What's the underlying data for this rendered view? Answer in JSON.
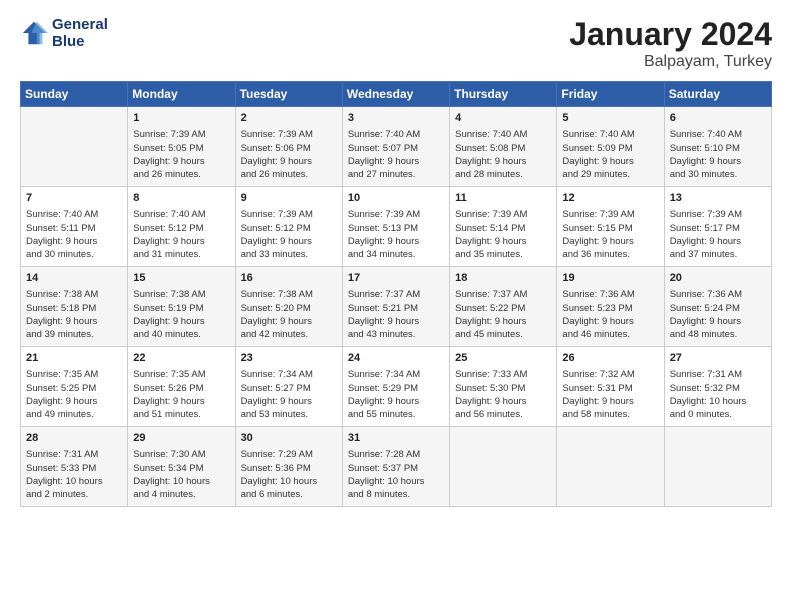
{
  "header": {
    "logo_line1": "General",
    "logo_line2": "Blue",
    "title": "January 2024",
    "subtitle": "Balpayam, Turkey"
  },
  "weekdays": [
    "Sunday",
    "Monday",
    "Tuesday",
    "Wednesday",
    "Thursday",
    "Friday",
    "Saturday"
  ],
  "weeks": [
    [
      {
        "day": "",
        "info": ""
      },
      {
        "day": "1",
        "info": "Sunrise: 7:39 AM\nSunset: 5:05 PM\nDaylight: 9 hours\nand 26 minutes."
      },
      {
        "day": "2",
        "info": "Sunrise: 7:39 AM\nSunset: 5:06 PM\nDaylight: 9 hours\nand 26 minutes."
      },
      {
        "day": "3",
        "info": "Sunrise: 7:40 AM\nSunset: 5:07 PM\nDaylight: 9 hours\nand 27 minutes."
      },
      {
        "day": "4",
        "info": "Sunrise: 7:40 AM\nSunset: 5:08 PM\nDaylight: 9 hours\nand 28 minutes."
      },
      {
        "day": "5",
        "info": "Sunrise: 7:40 AM\nSunset: 5:09 PM\nDaylight: 9 hours\nand 29 minutes."
      },
      {
        "day": "6",
        "info": "Sunrise: 7:40 AM\nSunset: 5:10 PM\nDaylight: 9 hours\nand 30 minutes."
      }
    ],
    [
      {
        "day": "7",
        "info": "Sunrise: 7:40 AM\nSunset: 5:11 PM\nDaylight: 9 hours\nand 30 minutes."
      },
      {
        "day": "8",
        "info": "Sunrise: 7:40 AM\nSunset: 5:12 PM\nDaylight: 9 hours\nand 31 minutes."
      },
      {
        "day": "9",
        "info": "Sunrise: 7:39 AM\nSunset: 5:12 PM\nDaylight: 9 hours\nand 33 minutes."
      },
      {
        "day": "10",
        "info": "Sunrise: 7:39 AM\nSunset: 5:13 PM\nDaylight: 9 hours\nand 34 minutes."
      },
      {
        "day": "11",
        "info": "Sunrise: 7:39 AM\nSunset: 5:14 PM\nDaylight: 9 hours\nand 35 minutes."
      },
      {
        "day": "12",
        "info": "Sunrise: 7:39 AM\nSunset: 5:15 PM\nDaylight: 9 hours\nand 36 minutes."
      },
      {
        "day": "13",
        "info": "Sunrise: 7:39 AM\nSunset: 5:17 PM\nDaylight: 9 hours\nand 37 minutes."
      }
    ],
    [
      {
        "day": "14",
        "info": "Sunrise: 7:38 AM\nSunset: 5:18 PM\nDaylight: 9 hours\nand 39 minutes."
      },
      {
        "day": "15",
        "info": "Sunrise: 7:38 AM\nSunset: 5:19 PM\nDaylight: 9 hours\nand 40 minutes."
      },
      {
        "day": "16",
        "info": "Sunrise: 7:38 AM\nSunset: 5:20 PM\nDaylight: 9 hours\nand 42 minutes."
      },
      {
        "day": "17",
        "info": "Sunrise: 7:37 AM\nSunset: 5:21 PM\nDaylight: 9 hours\nand 43 minutes."
      },
      {
        "day": "18",
        "info": "Sunrise: 7:37 AM\nSunset: 5:22 PM\nDaylight: 9 hours\nand 45 minutes."
      },
      {
        "day": "19",
        "info": "Sunrise: 7:36 AM\nSunset: 5:23 PM\nDaylight: 9 hours\nand 46 minutes."
      },
      {
        "day": "20",
        "info": "Sunrise: 7:36 AM\nSunset: 5:24 PM\nDaylight: 9 hours\nand 48 minutes."
      }
    ],
    [
      {
        "day": "21",
        "info": "Sunrise: 7:35 AM\nSunset: 5:25 PM\nDaylight: 9 hours\nand 49 minutes."
      },
      {
        "day": "22",
        "info": "Sunrise: 7:35 AM\nSunset: 5:26 PM\nDaylight: 9 hours\nand 51 minutes."
      },
      {
        "day": "23",
        "info": "Sunrise: 7:34 AM\nSunset: 5:27 PM\nDaylight: 9 hours\nand 53 minutes."
      },
      {
        "day": "24",
        "info": "Sunrise: 7:34 AM\nSunset: 5:29 PM\nDaylight: 9 hours\nand 55 minutes."
      },
      {
        "day": "25",
        "info": "Sunrise: 7:33 AM\nSunset: 5:30 PM\nDaylight: 9 hours\nand 56 minutes."
      },
      {
        "day": "26",
        "info": "Sunrise: 7:32 AM\nSunset: 5:31 PM\nDaylight: 9 hours\nand 58 minutes."
      },
      {
        "day": "27",
        "info": "Sunrise: 7:31 AM\nSunset: 5:32 PM\nDaylight: 10 hours\nand 0 minutes."
      }
    ],
    [
      {
        "day": "28",
        "info": "Sunrise: 7:31 AM\nSunset: 5:33 PM\nDaylight: 10 hours\nand 2 minutes."
      },
      {
        "day": "29",
        "info": "Sunrise: 7:30 AM\nSunset: 5:34 PM\nDaylight: 10 hours\nand 4 minutes."
      },
      {
        "day": "30",
        "info": "Sunrise: 7:29 AM\nSunset: 5:36 PM\nDaylight: 10 hours\nand 6 minutes."
      },
      {
        "day": "31",
        "info": "Sunrise: 7:28 AM\nSunset: 5:37 PM\nDaylight: 10 hours\nand 8 minutes."
      },
      {
        "day": "",
        "info": ""
      },
      {
        "day": "",
        "info": ""
      },
      {
        "day": "",
        "info": ""
      }
    ]
  ]
}
